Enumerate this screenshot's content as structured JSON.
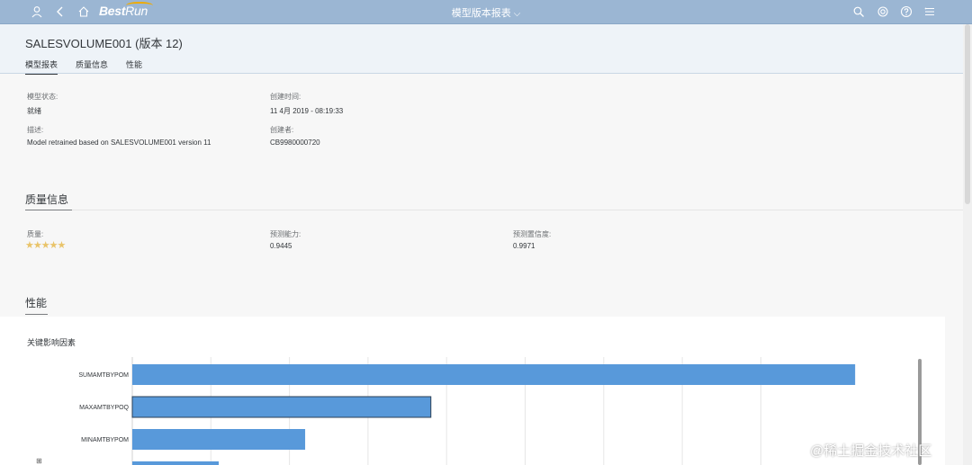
{
  "shell": {
    "logo_bold": "Best",
    "logo_light": "Run",
    "app_title": "模型版本报表",
    "title_chevron": "⌵"
  },
  "header": {
    "object_title": "SALESVOLUME001 (版本 12)",
    "tabs": [
      {
        "label": "模型报表",
        "active": true
      },
      {
        "label": "质量信息",
        "active": false
      },
      {
        "label": "性能",
        "active": false
      }
    ]
  },
  "overview": {
    "status_label": "模型状态:",
    "status_value": "就绪",
    "created_label": "创建时间:",
    "created_value": "11 4月 2019 - 08:19:33",
    "desc_label": "描述:",
    "desc_value": "Model retrained based on SALESVOLUME001 version 11",
    "creator_label": "创建者:",
    "creator_value": "CB9980000720"
  },
  "quality": {
    "section_title": "质量信息",
    "quality_label": "质量:",
    "stars": "★★★★★",
    "rating": 5,
    "predictive_power_label": "预测能力:",
    "predictive_power_value": "0.9445",
    "confidence_label": "预测置信度:",
    "confidence_value": "0.9971"
  },
  "performance": {
    "section_title": "性能",
    "chart_title": "关键影响因素"
  },
  "colors": {
    "shellbar": "#9bb6d3",
    "bar": "#5899da",
    "star": "#e9c46a"
  },
  "chart_data": {
    "type": "bar",
    "orientation": "horizontal",
    "title": "关键影响因素",
    "categories": [
      "SUMAMTBYPOM",
      "MAXAMTBYPOQ",
      "MINAMTBYPOM",
      ""
    ],
    "values": [
      0.92,
      0.38,
      0.22,
      0.11
    ],
    "xlim": [
      0,
      1
    ],
    "grid": true,
    "legend": "none"
  },
  "watermark": "@稀土掘金技术社区",
  "side_mark": "⊞"
}
